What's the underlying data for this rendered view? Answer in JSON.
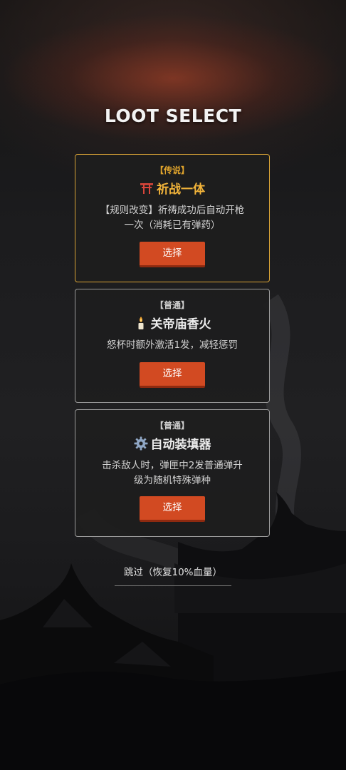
{
  "title": "LOOT SELECT",
  "cards": [
    {
      "tier": "【传说】",
      "rarity": "legendary",
      "icon": "torii-gate-icon",
      "name": "祈战一体",
      "desc_lines": [
        "【规则改变】祈祷成功后自动开枪",
        "一次（消耗已有弹药）"
      ],
      "button": "选择"
    },
    {
      "tier": "【普通】",
      "rarity": "common",
      "icon": "candle-icon",
      "name": "关帝庙香火",
      "desc_lines": [
        "怒杯时额外激活1发，减轻惩罚"
      ],
      "button": "选择"
    },
    {
      "tier": "【普通】",
      "rarity": "common",
      "icon": "gear-icon",
      "name": "自动装填器",
      "desc_lines": [
        "击杀敌人时，弹匣中2发普通弹升",
        "级为随机特殊弹种"
      ],
      "button": "选择"
    }
  ],
  "skip_label": "跳过（恢复10%血量）",
  "colors": {
    "legendary": "#d7a236",
    "common_border": "#9a9a9a",
    "button": "#d24a22"
  }
}
